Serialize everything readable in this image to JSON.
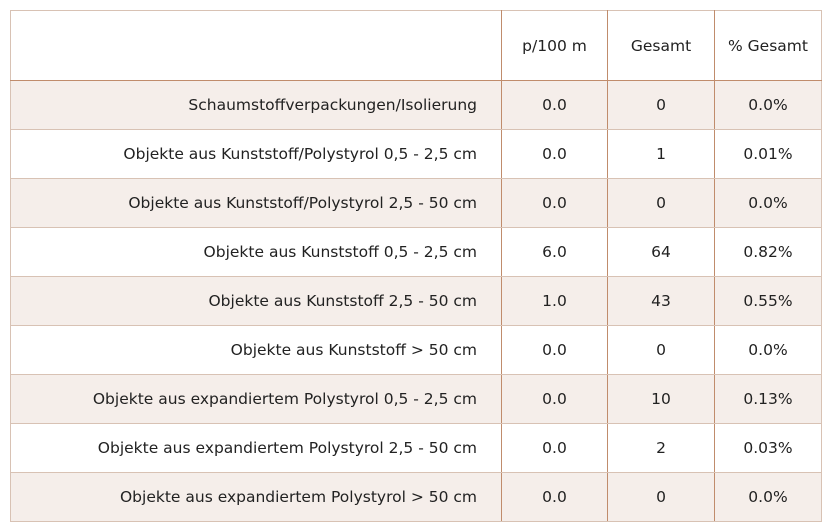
{
  "table": {
    "headers": {
      "label": "",
      "per_100m": "p/100 m",
      "total": "Gesamt",
      "percent_total": "% Gesamt"
    },
    "rows": [
      {
        "label": "Schaumstoffverpackungen/Isolierung",
        "per_100m": "0.0",
        "total": "0",
        "percent_total": "0.0%"
      },
      {
        "label": "Objekte aus Kunststoff/Polystyrol 0,5 - 2,5 cm",
        "per_100m": "0.0",
        "total": "1",
        "percent_total": "0.01%"
      },
      {
        "label": "Objekte aus Kunststoff/Polystyrol 2,5 - 50 cm",
        "per_100m": "0.0",
        "total": "0",
        "percent_total": "0.0%"
      },
      {
        "label": "Objekte aus Kunststoff 0,5 - 2,5 cm",
        "per_100m": "6.0",
        "total": "64",
        "percent_total": "0.82%"
      },
      {
        "label": "Objekte aus Kunststoff 2,5 - 50 cm",
        "per_100m": "1.0",
        "total": "43",
        "percent_total": "0.55%"
      },
      {
        "label": "Objekte aus Kunststoff > 50 cm",
        "per_100m": "0.0",
        "total": "0",
        "percent_total": "0.0%"
      },
      {
        "label": "Objekte aus expandiertem Polystyrol 0,5 - 2,5 cm",
        "per_100m": "0.0",
        "total": "10",
        "percent_total": "0.13%"
      },
      {
        "label": "Objekte aus expandiertem Polystyrol 2,5 - 50 cm",
        "per_100m": "0.0",
        "total": "2",
        "percent_total": "0.03%"
      },
      {
        "label": "Objekte aus expandiertem Polystyrol > 50 cm",
        "per_100m": "0.0",
        "total": "0",
        "percent_total": "0.0%"
      }
    ]
  },
  "colors": {
    "row_shade": "#f5eeea",
    "row_plain": "#ffffff",
    "grid_line": "#c08c6c",
    "outer_border": "#d8c2b4",
    "text": "#222222"
  }
}
